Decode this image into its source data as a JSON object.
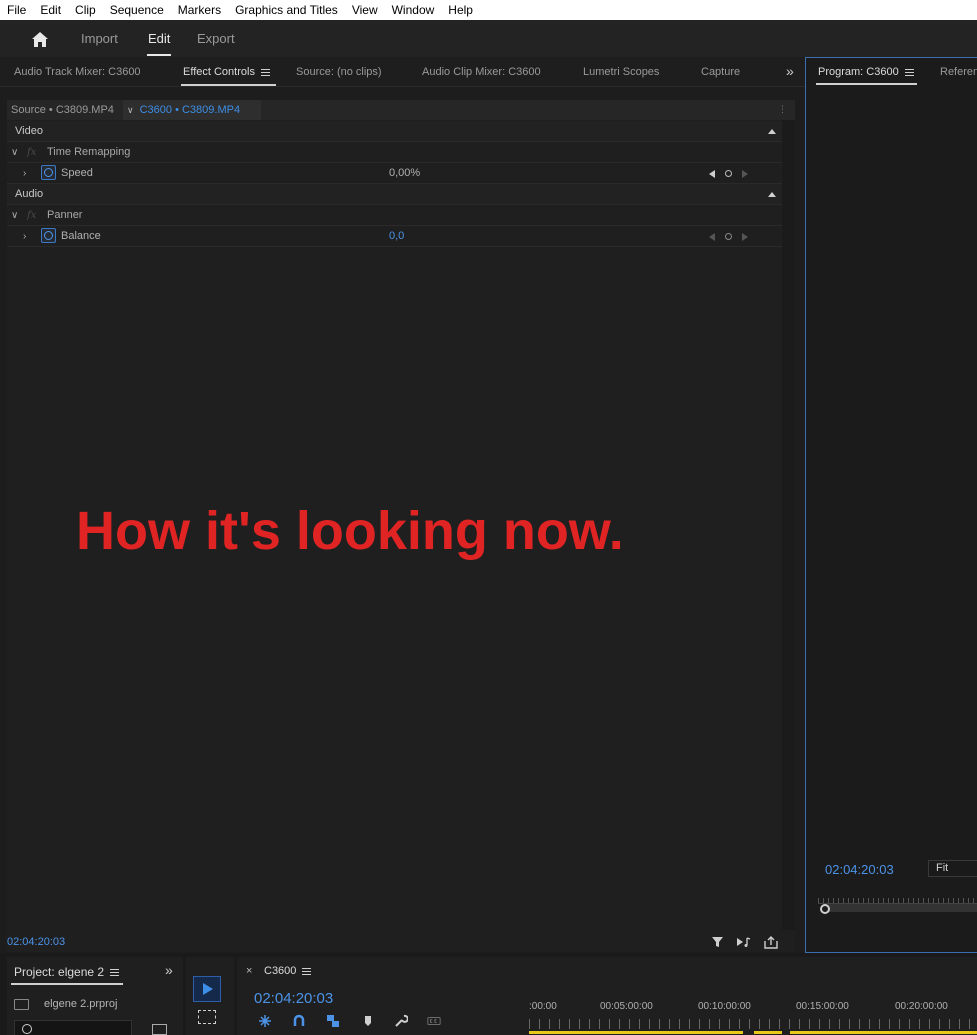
{
  "menu": [
    "File",
    "Edit",
    "Clip",
    "Sequence",
    "Markers",
    "Graphics and Titles",
    "View",
    "Window",
    "Help"
  ],
  "workspace": {
    "tabs": [
      "Import",
      "Edit",
      "Export"
    ],
    "active": "Edit"
  },
  "panel_tabs": {
    "audio_track_mixer": "Audio Track Mixer: C3600",
    "effect_controls": "Effect Controls",
    "source": "Source: (no clips)",
    "audio_clip_mixer": "Audio Clip Mixer: C3600",
    "lumetri_scopes": "Lumetri Scopes",
    "capture": "Capture",
    "overflow": "»"
  },
  "effect_controls": {
    "source_tab": "Source • C3809.MP4",
    "sequence_tab": "C3600 • C3809.MP4",
    "sections": {
      "video": "Video",
      "time_remapping": "Time Remapping",
      "speed_label": "Speed",
      "speed_value": "0,00%",
      "audio": "Audio",
      "panner": "Panner",
      "balance_label": "Balance",
      "balance_value": "0,0",
      "fx": "fx"
    },
    "timecode": "02:04:20:03"
  },
  "annotation": "How it's looking now.",
  "program": {
    "tab": "Program: C3600",
    "reference_tab": "Referen",
    "timecode": "02:04:20:03",
    "zoom": "Fit"
  },
  "project": {
    "tab": "Project: elgene 2",
    "file": "elgene 2.prproj",
    "overflow": "»"
  },
  "timeline": {
    "close": "×",
    "tab": "C3600",
    "timecode": "02:04:20:03",
    "ruler_labels": [
      ":00:00",
      "00:05:00:00",
      "00:10:00:00",
      "00:15:00:00",
      "00:20:00:00"
    ]
  },
  "colors": {
    "accent_blue": "#4c93e8",
    "annotation_red": "#e02424",
    "work_area": "#e8c91a"
  }
}
